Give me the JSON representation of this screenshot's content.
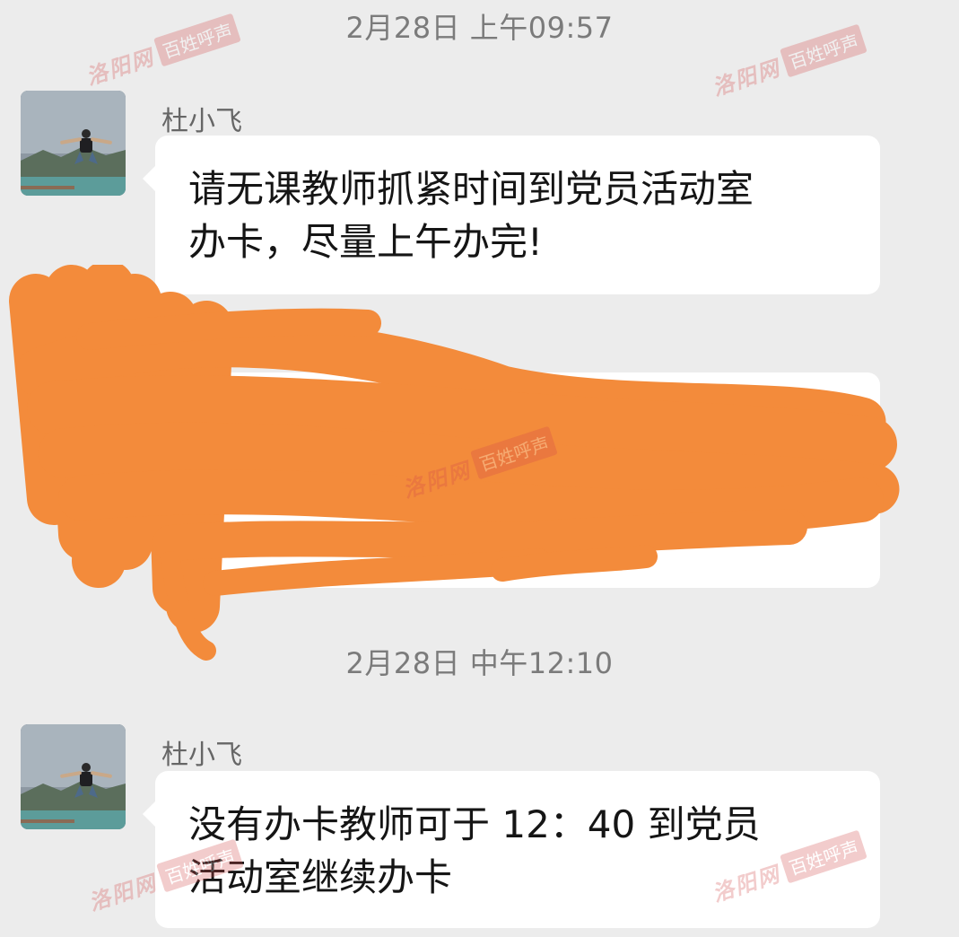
{
  "messages": [
    {
      "timestamp": "2月28日 上午09:57",
      "sender": "杜小飞",
      "text": "请无课教师抓紧时间到党员活动室\n办卡，尽量上午办完!"
    },
    {
      "timestamp": "2月28日 中午12:10",
      "sender": "杜小飞",
      "text": "没有办卡教师可于 12：40 到党员\n活动室继续办卡"
    }
  ],
  "watermark": {
    "site": "洛阳网",
    "tag": "百姓呼声"
  },
  "colors": {
    "background": "#ececec",
    "bubble": "#ffffff",
    "redaction": "#f38b3b",
    "watermark": "#d44a4a"
  }
}
